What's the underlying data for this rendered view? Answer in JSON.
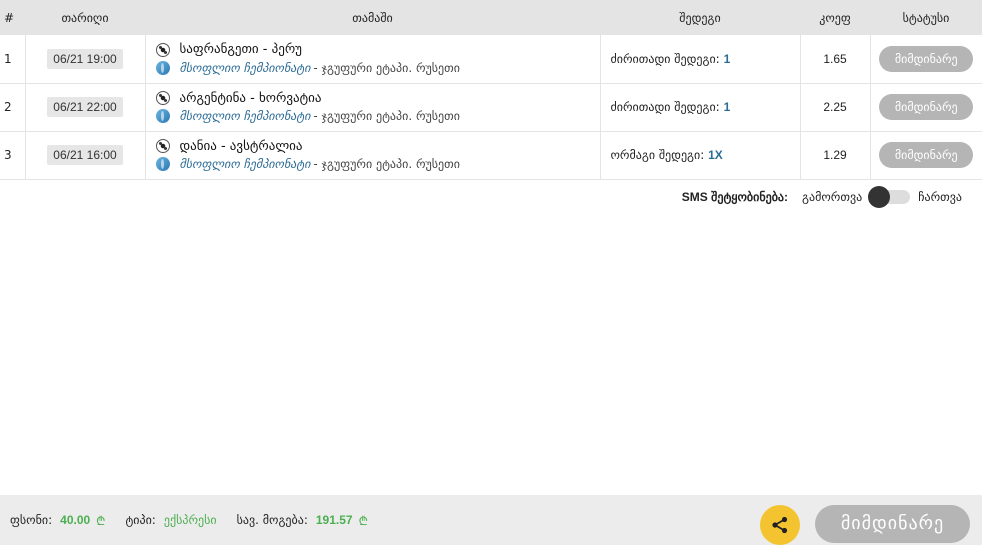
{
  "headers": {
    "num": "#",
    "date": "თარიღი",
    "game": "თამაში",
    "result": "შედეგი",
    "coef": "კოეფ",
    "status": "სტატუსი"
  },
  "rows": [
    {
      "num": "1",
      "date": "06/21 19:00",
      "teams": "საფრანგეთი - პერუ",
      "league": "მსოფლიო ჩემპიონატი",
      "stage": "- ჯგუფური ეტაპი. რუსეთი",
      "result_label": "ძირითადი შედეგი:",
      "result_value": "1",
      "coef": "1.65",
      "status": "მიმდინარე"
    },
    {
      "num": "2",
      "date": "06/21 22:00",
      "teams": "არგენტინა - ხორვატია",
      "league": "მსოფლიო ჩემპიონატი",
      "stage": "- ჯგუფური ეტაპი. რუსეთი",
      "result_label": "ძირითადი შედეგი:",
      "result_value": "1",
      "coef": "2.25",
      "status": "მიმდინარე"
    },
    {
      "num": "3",
      "date": "06/21 16:00",
      "teams": "დანია - ავსტრალია",
      "league": "მსოფლიო ჩემპიონატი",
      "stage": "- ჯგუფური ეტაპი. რუსეთი",
      "result_label": "ორმაგი შედეგი:",
      "result_value": "1X",
      "coef": "1.29",
      "status": "მიმდინარე"
    }
  ],
  "sms": {
    "label": "SMS შეტყობინება:",
    "off": "გამორთვა",
    "on": "ჩართვა",
    "enabled": false
  },
  "footer": {
    "stake_label": "ფსონი:",
    "stake_value": "40.00",
    "type_label": "ტიპი:",
    "type_value": "ექსპრესი",
    "win_label": "სავ. მოგება:",
    "win_value": "191.57",
    "currency": "₾",
    "status": "მიმდინარე"
  },
  "colors": {
    "accent_green": "#4caf50",
    "share_yellow": "#f4c430",
    "status_gray": "#b5b5b5",
    "link_blue": "#2b6c96"
  },
  "icons": [
    "soccer-ball-icon",
    "globe-icon",
    "share-icon",
    "lari-icon"
  ]
}
